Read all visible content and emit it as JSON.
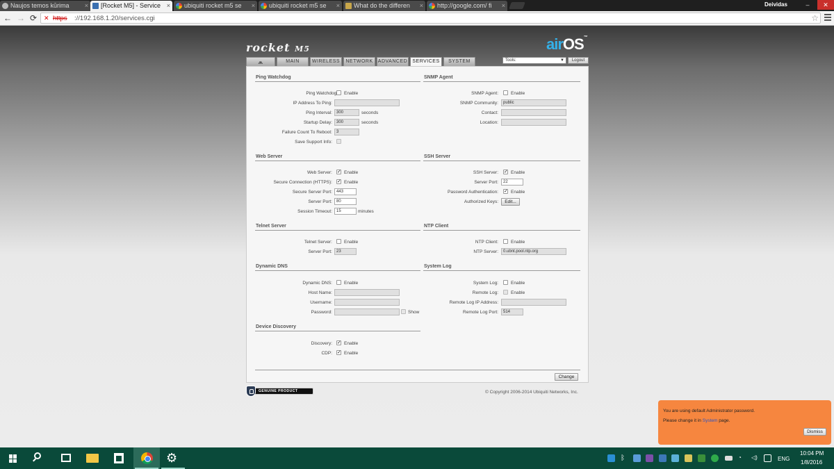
{
  "browser": {
    "tabs": [
      {
        "title": "Naujos temos kūrima",
        "favicon": "forum-icon"
      },
      {
        "title": "[Rocket M5] - Service",
        "favicon": "ubnt-icon"
      },
      {
        "title": "ubiquiti rocket m5 se",
        "favicon": "google-icon"
      },
      {
        "title": "ubiquiti rocket m5 se",
        "favicon": "google-icon"
      },
      {
        "title": "What do the differen",
        "favicon": "site-icon"
      },
      {
        "title": "http://google.com/ fi",
        "favicon": "google-icon"
      }
    ],
    "active_tab": 1,
    "profile_name": "Deividas",
    "url_scheme": "https",
    "url_rest": "://192.168.1.20/services.cgi",
    "close_glyph": "×"
  },
  "device": {
    "brand": "rocket",
    "model": "M5",
    "os_logo_air": "air",
    "os_logo_os": "OS",
    "os_logo_tm": "™"
  },
  "nav": {
    "logo_tab_icon": "ubnt-logo-icon",
    "tabs": [
      "MAIN",
      "WIRELESS",
      "NETWORK",
      "ADVANCED",
      "SERVICES",
      "SYSTEM"
    ],
    "active": "SERVICES",
    "tools_label": "Tools:",
    "logout_label": "Logout"
  },
  "sections": {
    "ping_watchdog": {
      "title": "Ping Watchdog",
      "ping_watchdog_label": "Ping Watchdog:",
      "enable_label": "Enable",
      "ping_watchdog_enabled": false,
      "ip_to_ping_label": "IP Address To Ping:",
      "ip_to_ping_value": "",
      "ping_interval_label": "Ping Interval:",
      "ping_interval_value": "300",
      "startup_delay_label": "Startup Delay:",
      "startup_delay_value": "300",
      "seconds_label": "seconds",
      "failure_count_label": "Failure Count To Reboot:",
      "failure_count_value": "3",
      "save_support_label": "Save Support Info:",
      "save_support_enabled": false
    },
    "snmp_agent": {
      "title": "SNMP Agent",
      "snmp_agent_label": "SNMP Agent:",
      "enable_label": "Enable",
      "snmp_enabled": false,
      "community_label": "SNMP Community:",
      "community_value": "public",
      "contact_label": "Contact:",
      "contact_value": "",
      "location_label": "Location:",
      "location_value": ""
    },
    "web_server": {
      "title": "Web Server",
      "web_server_label": "Web Server:",
      "enable_label": "Enable",
      "web_server_enabled": true,
      "https_label": "Secure Connection (HTTPS):",
      "https_enabled": true,
      "secure_port_label": "Secure Server Port:",
      "secure_port_value": "443",
      "server_port_label": "Server Port:",
      "server_port_value": "80",
      "session_timeout_label": "Session Timeout:",
      "session_timeout_value": "15",
      "minutes_label": "minutes"
    },
    "ssh_server": {
      "title": "SSH Server",
      "ssh_label": "SSH Server:",
      "enable_label": "Enable",
      "ssh_enabled": true,
      "port_label": "Server Port:",
      "port_value": "22",
      "password_auth_label": "Password Authentication:",
      "password_auth_enabled": true,
      "authorized_keys_label": "Authorized Keys:",
      "edit_button": "Edit..."
    },
    "telnet_server": {
      "title": "Telnet Server",
      "telnet_label": "Telnet Server:",
      "enable_label": "Enable",
      "telnet_enabled": false,
      "port_label": "Server Port:",
      "port_value": "23"
    },
    "ntp_client": {
      "title": "NTP Client",
      "ntp_label": "NTP Client:",
      "enable_label": "Enable",
      "ntp_enabled": false,
      "server_label": "NTP Server:",
      "server_value": "0.ubnt.pool.ntp.org"
    },
    "dynamic_dns": {
      "title": "Dynamic DNS",
      "ddns_label": "Dynamic DNS:",
      "enable_label": "Enable",
      "ddns_enabled": false,
      "host_label": "Host Name:",
      "host_value": "",
      "username_label": "Username:",
      "username_value": "",
      "password_label": "Password:",
      "password_value": "",
      "show_label": "Show"
    },
    "system_log": {
      "title": "System Log",
      "system_log_label": "System Log:",
      "enable_label": "Enable",
      "system_log_enabled": false,
      "remote_log_label": "Remote Log:",
      "remote_log_enabled": false,
      "remote_ip_label": "Remote Log IP Address:",
      "remote_ip_value": "",
      "remote_port_label": "Remote Log Port:",
      "remote_port_value": "514"
    },
    "device_discovery": {
      "title": "Device Discovery",
      "discovery_label": "Discovery:",
      "enable_label": "Enable",
      "discovery_enabled": true,
      "cdp_label": "CDP:",
      "cdp_enabled": true
    }
  },
  "change_button": "Change",
  "genuine_badge": "GENUINE   PRODUCT",
  "copyright": "© Copyright 2006-2014 Ubiquiti Networks, Inc.",
  "notification": {
    "line1": "You are using default Administrator password.",
    "line2_prefix": "Please change it in ",
    "line2_link": "System",
    "line2_suffix": " page.",
    "dismiss": "Dismiss",
    "background": "#f6863f"
  },
  "taskbar": {
    "language": "ENG",
    "time": "10:04 PM",
    "date": "1/8/2016",
    "color": "#0a4a3a"
  }
}
